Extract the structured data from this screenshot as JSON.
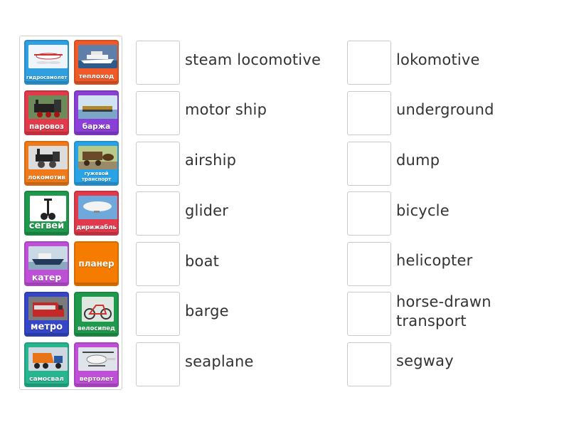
{
  "tiles": [
    {
      "label": "гидросамолет",
      "color": "#2f9fe0",
      "icon": "seaplane-image"
    },
    {
      "label": "теплоход",
      "color": "#ef5a28",
      "icon": "motor-ship-image"
    },
    {
      "label": "паровоз",
      "color": "#e23a4b",
      "icon": "steam-locomotive-image"
    },
    {
      "label": "баржа",
      "color": "#8b3fd9",
      "icon": "barge-image"
    },
    {
      "label": "локомотив",
      "color": "#f07a1a",
      "icon": "locomotive-image"
    },
    {
      "label": "гужевой транспорт",
      "color": "#2aa3e6",
      "icon": "horse-drawn-image"
    },
    {
      "label": "сегвей",
      "color": "#1f9a4c",
      "icon": "segway-image"
    },
    {
      "label": "дирижабль",
      "color": "#e23a4b",
      "icon": "airship-image"
    },
    {
      "label": "катер",
      "color": "#c04fd8",
      "icon": "boat-image"
    },
    {
      "label": "планер",
      "color": "#f57c00",
      "icon": "none"
    },
    {
      "label": "метро",
      "color": "#3546c9",
      "icon": "metro-image"
    },
    {
      "label": "велосипед",
      "color": "#1f9a4c",
      "icon": "bicycle-image"
    },
    {
      "label": "самосвал",
      "color": "#26b58f",
      "icon": "dump-truck-image"
    },
    {
      "label": "вертолет",
      "color": "#c04fd8",
      "icon": "helicopter-image"
    }
  ],
  "left_column": [
    "steam locomotive",
    "motor ship",
    "airship",
    "glider",
    "boat",
    "barge",
    "seaplane"
  ],
  "right_column": [
    "lokomotive",
    "underground",
    "dump",
    "bicycle",
    "helicopter",
    "horse-drawn\ntransport",
    "segway"
  ]
}
